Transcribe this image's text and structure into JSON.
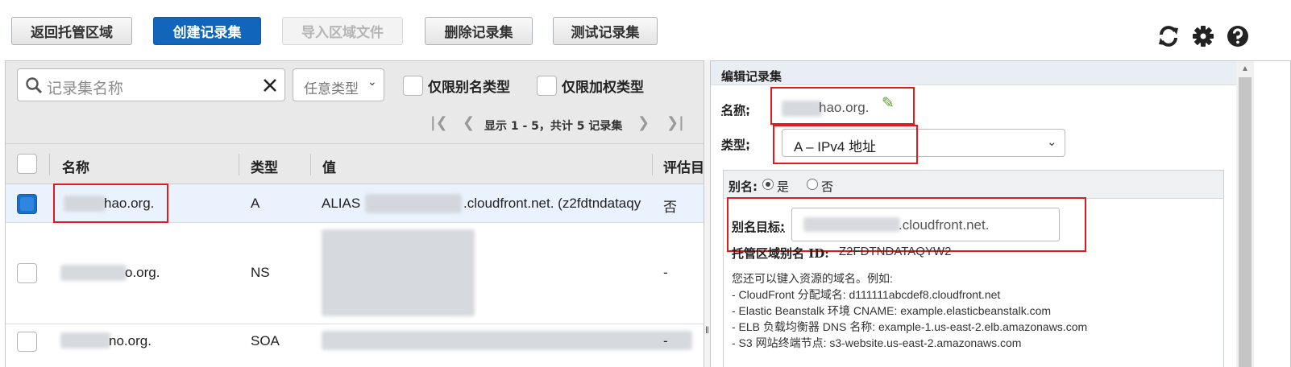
{
  "toolbar": {
    "back_label": "返回托管区域",
    "create_label": "创建记录集",
    "import_label": "导入区域文件",
    "delete_label": "删除记录集",
    "test_label": "测试记录集",
    "icons": [
      "refresh-icon",
      "gear-icon",
      "help-icon"
    ]
  },
  "filter": {
    "search_placeholder": "记录集名称",
    "type_select": "任意类型",
    "alias_only_label": "仅限别名类型",
    "weighted_only_label": "仅限加权类型",
    "pager_text": "显示 1 - 5，共计 5 记录集"
  },
  "table": {
    "columns": [
      "名称",
      "类型",
      "值",
      "评估目"
    ],
    "rows": [
      {
        "name": "hao.org.",
        "type": "A",
        "value_start": "ALIAS",
        "value_end": ".cloudfront.net. (z2fdtndataqy",
        "eval": "否",
        "selected": true
      },
      {
        "name": "o.org.",
        "type": "NS",
        "eval": "-",
        "selected": false
      },
      {
        "name": "no.org.",
        "type": "SOA",
        "eval": "-",
        "selected": false
      }
    ]
  },
  "editor": {
    "header": "编辑记录集",
    "name_label": "名称:",
    "name_value": "hao.org.",
    "type_label": "类型:",
    "type_value": "A – IPv4 地址",
    "alias_label": "别名:",
    "alias_yes": "是",
    "alias_no": "否",
    "alias_target_label": "别名目标:",
    "alias_target_value": ".cloudfront.net.",
    "hosted_zone_label": "托管区域别名 ID:",
    "hosted_zone_id": "Z2FDTNDATAQYW2",
    "help_intro": "您还可以键入资源的域名。例如:",
    "help_lines": [
      "- CloudFront 分配域名: d111111abcdef8.cloudfront.net",
      "- Elastic Beanstalk 环境 CNAME: example.elasticbeanstalk.com",
      "- ELB 负载均衡器 DNS 名称: example-1.us-east-2.elb.amazonaws.com",
      "- S3 网站终端节点: s3-website.us-east-2.amazonaws.com"
    ]
  },
  "colors": {
    "primary": "#1166bb",
    "highlight": "#e11b1b",
    "selected_row": "#eaf3fd"
  }
}
